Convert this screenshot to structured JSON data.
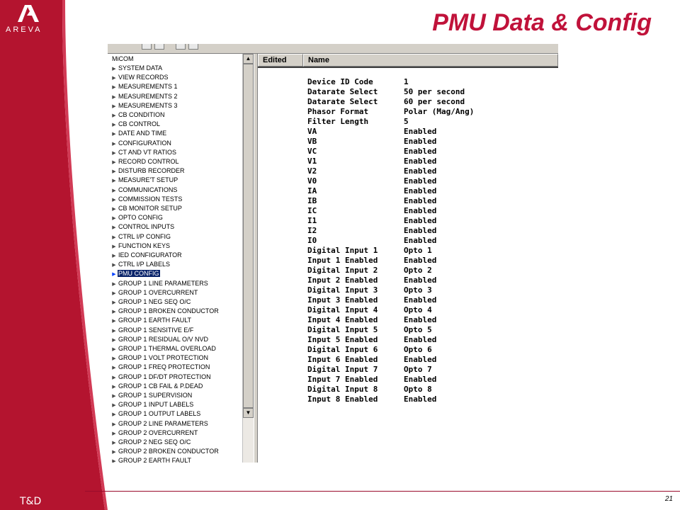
{
  "slide": {
    "title": "PMU Data & Config",
    "logo_text": "AREVA",
    "footer_label": "T&D",
    "page_number": "21",
    "brand_color": "#c0123a"
  },
  "tree": {
    "root": "MiCOM",
    "items": [
      {
        "label": "SYSTEM DATA"
      },
      {
        "label": "VIEW RECORDS"
      },
      {
        "label": "MEASUREMENTS 1"
      },
      {
        "label": "MEASUREMENTS 2"
      },
      {
        "label": "MEASUREMENTS 3"
      },
      {
        "label": "CB CONDITION"
      },
      {
        "label": "CB CONTROL"
      },
      {
        "label": "DATE AND TIME"
      },
      {
        "label": "CONFIGURATION"
      },
      {
        "label": "CT AND VT RATIOS"
      },
      {
        "label": "RECORD CONTROL"
      },
      {
        "label": "DISTURB RECORDER"
      },
      {
        "label": "MEASURE'T SETUP"
      },
      {
        "label": "COMMUNICATIONS"
      },
      {
        "label": "COMMISSION TESTS"
      },
      {
        "label": "CB MONITOR SETUP"
      },
      {
        "label": "OPTO CONFIG"
      },
      {
        "label": "CONTROL INPUTS"
      },
      {
        "label": "CTRL I/P CONFIG"
      },
      {
        "label": "FUNCTION KEYS"
      },
      {
        "label": "IED CONFIGURATOR"
      },
      {
        "label": "CTRL I/P LABELS"
      },
      {
        "label": "PMU CONFIG",
        "selected": true
      },
      {
        "label": "GROUP 1 LINE PARAMETERS"
      },
      {
        "label": "GROUP 1 OVERCURRENT"
      },
      {
        "label": "GROUP 1 NEG SEQ O/C"
      },
      {
        "label": "GROUP 1 BROKEN CONDUCTOR"
      },
      {
        "label": "GROUP 1 EARTH FAULT"
      },
      {
        "label": "GROUP 1 SENSITIVE E/F"
      },
      {
        "label": "GROUP 1 RESIDUAL O/V NVD"
      },
      {
        "label": "GROUP 1 THERMAL OVERLOAD"
      },
      {
        "label": "GROUP 1 VOLT PROTECTION"
      },
      {
        "label": "GROUP 1 FREQ PROTECTION"
      },
      {
        "label": "GROUP 1 DF/DT PROTECTION"
      },
      {
        "label": "GROUP 1 CB FAIL & P.DEAD"
      },
      {
        "label": "GROUP 1 SUPERVISION"
      },
      {
        "label": "GROUP 1 INPUT LABELS"
      },
      {
        "label": "GROUP 1 OUTPUT LABELS"
      },
      {
        "label": "GROUP 2 LINE PARAMETERS"
      },
      {
        "label": "GROUP 2 OVERCURRENT"
      },
      {
        "label": "GROUP 2 NEG SEQ O/C"
      },
      {
        "label": "GROUP 2 BROKEN CONDUCTOR"
      },
      {
        "label": "GROUP 2 EARTH FAULT"
      }
    ]
  },
  "grid": {
    "columns": [
      "Edited",
      "Name"
    ],
    "rows": [
      {
        "name": "Device ID Code",
        "value": "1"
      },
      {
        "name": "Datarate Select",
        "value": "50 per second"
      },
      {
        "name": "Datarate Select",
        "value": "60 per second"
      },
      {
        "name": "Phasor Format",
        "value": "Polar (Mag/Ang)"
      },
      {
        "name": "Filter Length",
        "value": "5"
      },
      {
        "name": "VA",
        "value": "Enabled"
      },
      {
        "name": "VB",
        "value": "Enabled"
      },
      {
        "name": "VC",
        "value": "Enabled"
      },
      {
        "name": "V1",
        "value": "Enabled"
      },
      {
        "name": "V2",
        "value": "Enabled"
      },
      {
        "name": "V0",
        "value": "Enabled"
      },
      {
        "name": "IA",
        "value": "Enabled"
      },
      {
        "name": "IB",
        "value": "Enabled"
      },
      {
        "name": "IC",
        "value": "Enabled"
      },
      {
        "name": "I1",
        "value": "Enabled"
      },
      {
        "name": "I2",
        "value": "Enabled"
      },
      {
        "name": "I0",
        "value": "Enabled"
      },
      {
        "name": "Digital Input 1",
        "value": "Opto 1"
      },
      {
        "name": "Input 1 Enabled",
        "value": "Enabled"
      },
      {
        "name": "Digital Input 2",
        "value": "Opto 2"
      },
      {
        "name": "Input 2 Enabled",
        "value": "Enabled"
      },
      {
        "name": "Digital Input 3",
        "value": "Opto 3"
      },
      {
        "name": "Input 3 Enabled",
        "value": "Enabled"
      },
      {
        "name": "Digital Input 4",
        "value": "Opto 4"
      },
      {
        "name": "Input 4 Enabled",
        "value": "Enabled"
      },
      {
        "name": "Digital Input 5",
        "value": "Opto 5"
      },
      {
        "name": "Input 5 Enabled",
        "value": "Enabled"
      },
      {
        "name": "Digital Input 6",
        "value": "Opto 6"
      },
      {
        "name": "Input 6 Enabled",
        "value": "Enabled"
      },
      {
        "name": "Digital Input 7",
        "value": "Opto 7"
      },
      {
        "name": "Input 7 Enabled",
        "value": "Enabled"
      },
      {
        "name": "Digital Input 8",
        "value": "Opto 8"
      },
      {
        "name": "Input 8 Enabled",
        "value": "Enabled"
      }
    ]
  }
}
